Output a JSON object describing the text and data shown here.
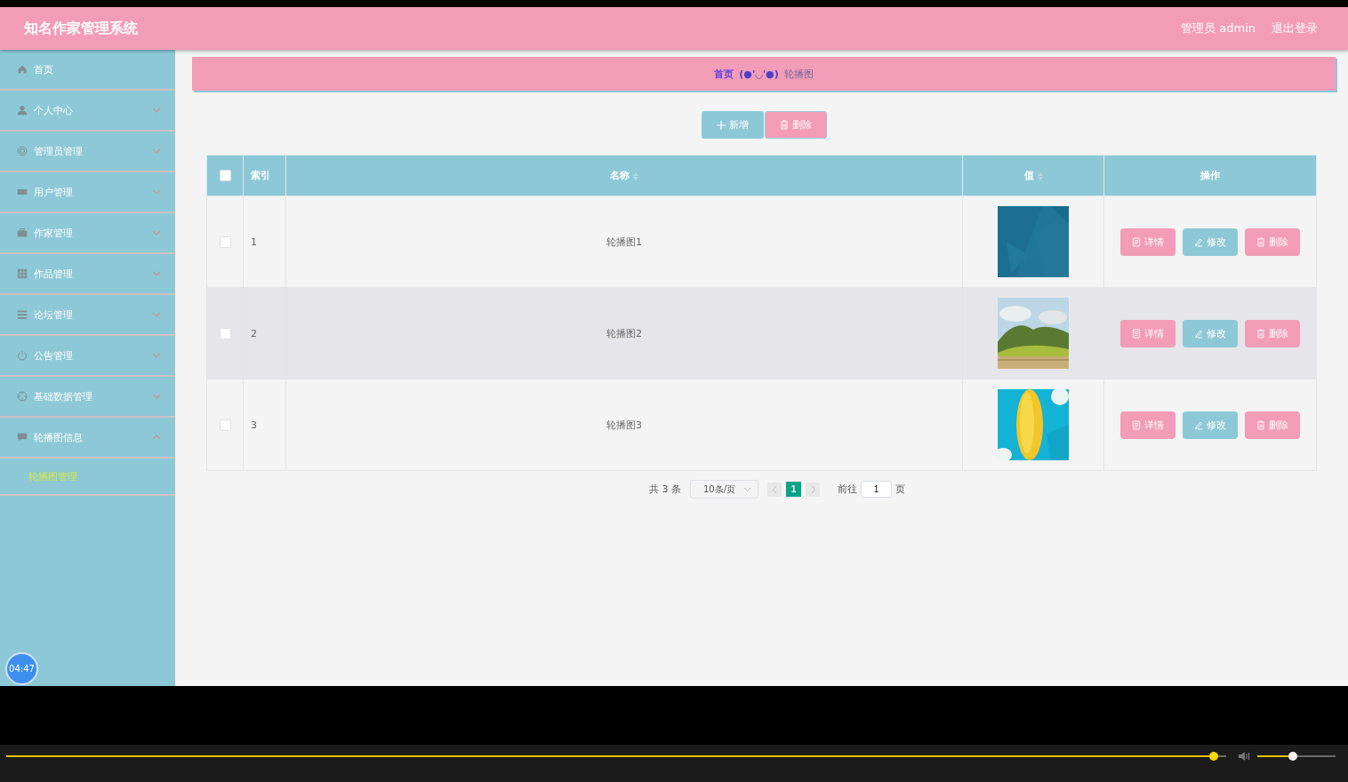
{
  "header": {
    "title": "知名作家管理系统",
    "user": "管理员 admin",
    "logout": "退出登录"
  },
  "sidebar": {
    "items": [
      {
        "label": "首页"
      },
      {
        "label": "个人中心",
        "expanded": false
      },
      {
        "label": "管理员管理",
        "expanded": false
      },
      {
        "label": "用户管理",
        "expanded": false
      },
      {
        "label": "作家管理",
        "expanded": false
      },
      {
        "label": "作品管理",
        "expanded": false
      },
      {
        "label": "论坛管理",
        "expanded": false
      },
      {
        "label": "公告管理",
        "expanded": false
      },
      {
        "label": "基础数据管理",
        "expanded": false
      },
      {
        "label": "轮播图信息",
        "expanded": true,
        "children": [
          {
            "label": "轮播图管理",
            "selected": true
          }
        ]
      }
    ]
  },
  "breadcrumb": {
    "home": "首页",
    "separator": "(●'◡'●)",
    "current": "轮播图"
  },
  "toolbar": {
    "add": "新增",
    "delete": "删除"
  },
  "table": {
    "header_checked": false,
    "columns": [
      {
        "label": "索引",
        "sortable": false
      },
      {
        "label": "名称",
        "sortable": true
      },
      {
        "label": "值",
        "sortable": true
      },
      {
        "label": "操作",
        "sortable": false
      }
    ],
    "rows": [
      {
        "checked": false,
        "highlighted": false,
        "index": "1",
        "name": "轮播图1",
        "value": {
          "kind": "picture"
        },
        "actions": [
          {
            "kind": "detail",
            "label": "详情"
          },
          {
            "kind": "edit",
            "label": "修改"
          },
          {
            "kind": "delete",
            "label": "删除"
          }
        ]
      },
      {
        "checked": false,
        "highlighted": true,
        "index": "2",
        "name": "轮播图2",
        "value": {
          "kind": "picture"
        },
        "actions": [
          {
            "kind": "detail",
            "label": "详情"
          },
          {
            "kind": "edit",
            "label": "修改"
          },
          {
            "kind": "delete",
            "label": "删除"
          }
        ]
      },
      {
        "checked": false,
        "highlighted": false,
        "index": "3",
        "name": "轮播图3",
        "value": {
          "kind": "picture"
        },
        "actions": [
          {
            "kind": "detail",
            "label": "详情"
          },
          {
            "kind": "edit",
            "label": "修改"
          },
          {
            "kind": "delete",
            "label": "删除"
          }
        ]
      }
    ]
  },
  "pagination": {
    "total": "共 3 条",
    "page_size": "10条/页",
    "pages": [
      {
        "label": "1",
        "selected": true
      }
    ],
    "goto": "前往",
    "goto_value": "1",
    "page_unit": "页"
  },
  "timer": "04:47",
  "player": {
    "progress": {
      "level": 0.99
    },
    "volume": {
      "level": 0.45
    }
  }
}
